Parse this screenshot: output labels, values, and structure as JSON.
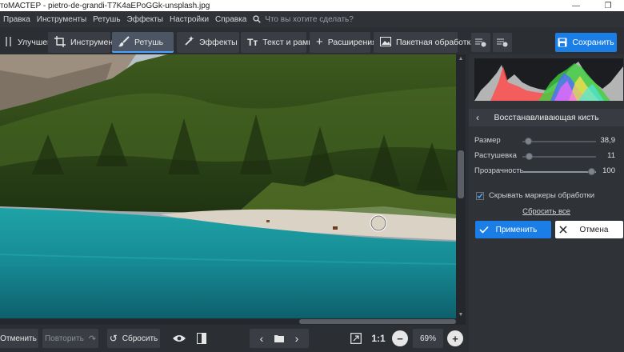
{
  "window": {
    "title": "тоМАСТЕР - pietro-de-grandi-T7K4aEPoGGk-unsplash.jpg",
    "minimize": "—",
    "maximize": "❐"
  },
  "menu": {
    "items": [
      "Правка",
      "Инструменты",
      "Ретушь",
      "Эффекты",
      "Настройки",
      "Справка"
    ],
    "search_placeholder": "Что вы хотите сделать?"
  },
  "toolbar": {
    "tabs": [
      {
        "label": "Улучшения",
        "icon": "sliders-icon"
      },
      {
        "label": "Инструменты",
        "icon": "crop-icon"
      },
      {
        "label": "Ретушь",
        "icon": "brush-icon",
        "active": true
      },
      {
        "label": "Эффекты",
        "icon": "magic-wand-icon"
      },
      {
        "label": "Текст и рамки",
        "icon": "text-icon"
      },
      {
        "label": "Расширения",
        "icon": "plus-icon"
      }
    ],
    "batch_label": "Пакетная обработка",
    "save_label": "Сохранить"
  },
  "panel": {
    "title": "Восстанавливающая кисть",
    "sliders": [
      {
        "label": "Размер",
        "value": "38,9",
        "position": 0.15
      },
      {
        "label": "Растушевка",
        "value": "11",
        "position": 0.11
      },
      {
        "label": "Прозрачность",
        "value": "100",
        "position": 1.0
      }
    ],
    "hide_markers_label": "Скрывать маркеры обработки",
    "hide_markers_checked": true,
    "reset_all_label": "Сбросить все",
    "apply_label": "Применить",
    "cancel_label": "Отмена"
  },
  "bottom": {
    "undo_label": "Отменить",
    "redo_label": "Повторить",
    "reset_label": "Сбросить",
    "ratio_label": "1:1",
    "zoom_value": "69%"
  },
  "colors": {
    "accent": "#1a7ee6",
    "background": "#2b2e33",
    "panel": "#2f3237"
  }
}
